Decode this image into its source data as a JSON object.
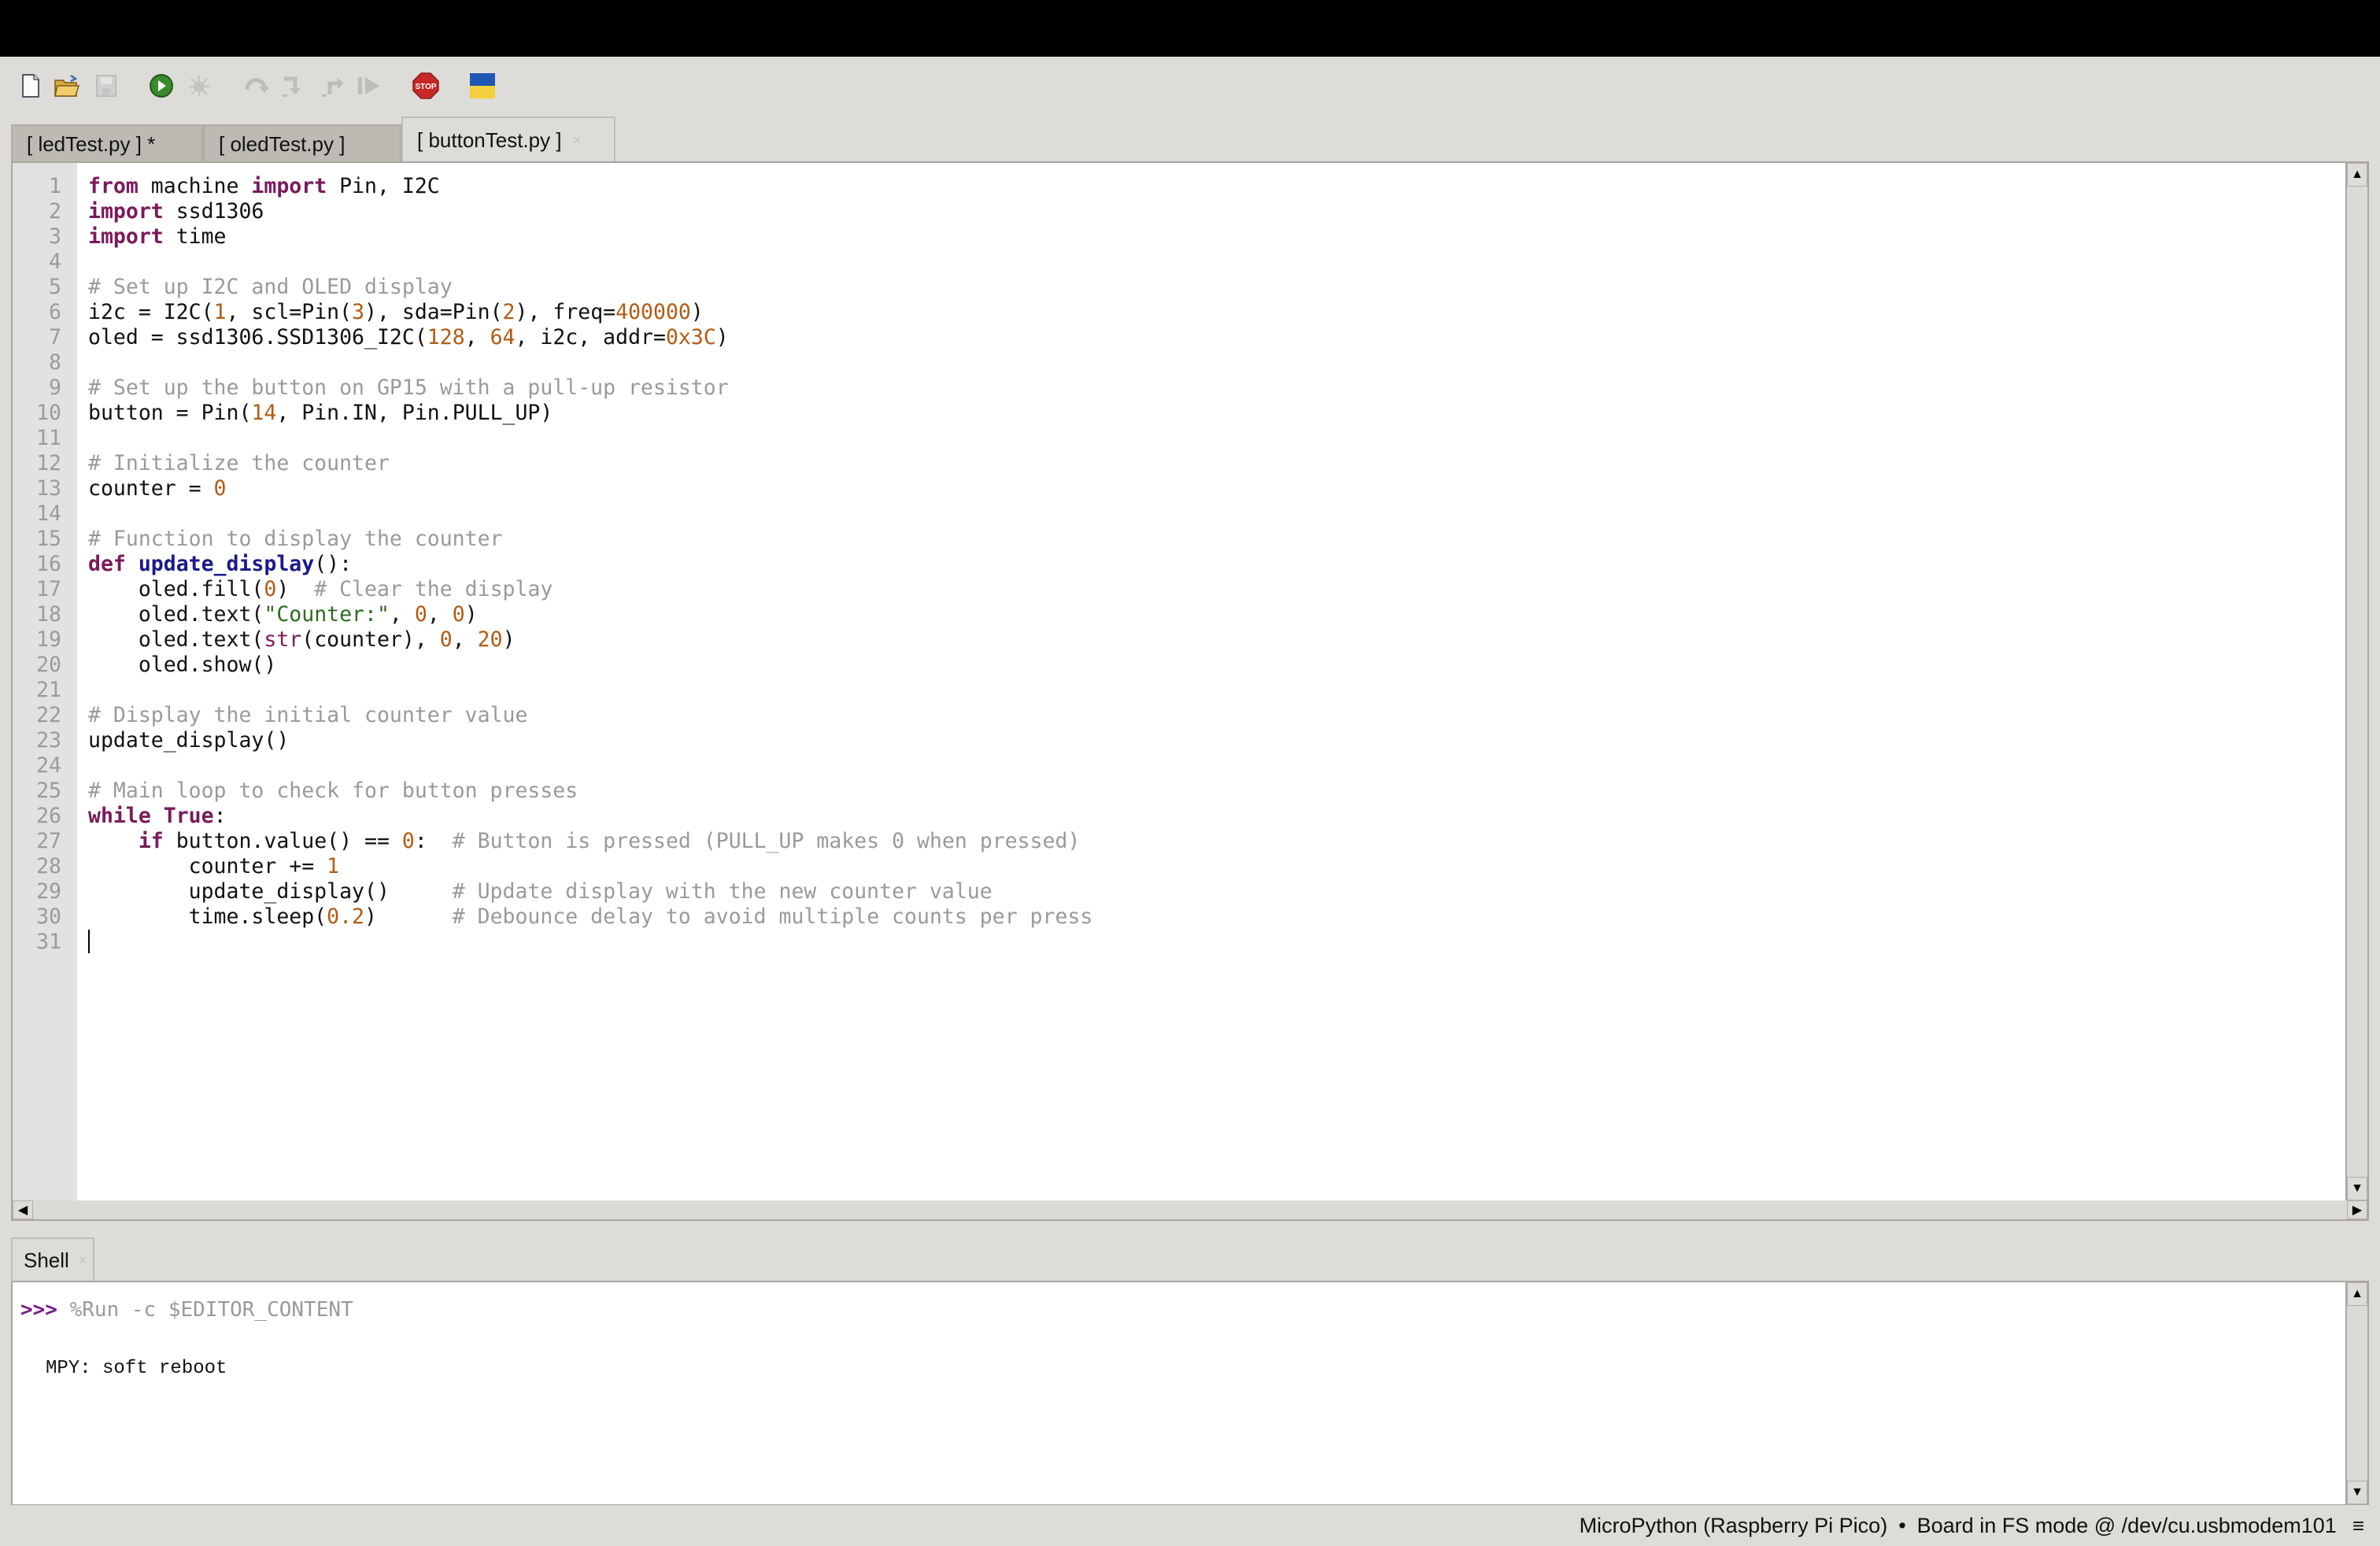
{
  "toolbar": {
    "buttons": [
      {
        "name": "new-file",
        "icon": "new-file-icon",
        "enabled": true
      },
      {
        "name": "open-file",
        "icon": "folder-open-icon",
        "enabled": true
      },
      {
        "name": "save-file",
        "icon": "save-icon",
        "enabled": false
      },
      {
        "name": "run",
        "icon": "play-icon",
        "enabled": true
      },
      {
        "name": "debug",
        "icon": "bug-icon",
        "enabled": false
      },
      {
        "name": "step-over",
        "icon": "step-over-icon",
        "enabled": false
      },
      {
        "name": "step-into",
        "icon": "step-into-icon",
        "enabled": false
      },
      {
        "name": "step-out",
        "icon": "step-out-icon",
        "enabled": false
      },
      {
        "name": "resume",
        "icon": "resume-icon",
        "enabled": false
      },
      {
        "name": "stop",
        "icon": "stop-icon",
        "label": "STOP",
        "enabled": true
      },
      {
        "name": "support-ukraine",
        "icon": "ukraine-flag-icon",
        "enabled": true
      }
    ],
    "colors": {
      "run": "#3a8a2e",
      "stop": "#c62828",
      "flag_blue": "#1f57b5",
      "flag_yellow": "#f2cf3c"
    }
  },
  "tabs": [
    {
      "label": "[ ledTest.py ] *",
      "active": false,
      "close": "×"
    },
    {
      "label": "[ oledTest.py ]",
      "active": false,
      "close": "×"
    },
    {
      "label": "[ buttonTest.py ]",
      "active": true,
      "close": "×"
    }
  ],
  "editor": {
    "lines": [
      [
        [
          "kw",
          "from"
        ],
        [
          "",
          "  machine "
        ],
        [
          "kw",
          "import"
        ],
        [
          "",
          " Pin, I2C"
        ]
      ],
      [
        [
          "kw",
          "import"
        ],
        [
          "",
          " ssd1306"
        ]
      ],
      [
        [
          "kw",
          "import"
        ],
        [
          "",
          " time"
        ]
      ],
      [],
      [
        [
          "cm",
          "# Set up I2C and OLED display"
        ]
      ],
      [
        [
          "",
          "i2c = I2C("
        ],
        [
          "num",
          "1"
        ],
        [
          "",
          ", scl=Pin("
        ],
        [
          "num",
          "3"
        ],
        [
          "",
          "), sda=Pin("
        ],
        [
          "num",
          "2"
        ],
        [
          "",
          "), freq="
        ],
        [
          "num",
          "400000"
        ],
        [
          "",
          ")"
        ]
      ],
      [
        [
          "",
          "oled = ssd1306.SSD1306_I2C("
        ],
        [
          "num",
          "128"
        ],
        [
          "",
          ", "
        ],
        [
          "num",
          "64"
        ],
        [
          "",
          ", i2c, addr="
        ],
        [
          "num",
          "0x3C"
        ],
        [
          "",
          ")"
        ]
      ],
      [],
      [
        [
          "cm",
          "# Set up the button on GP15 with a pull-up resistor"
        ]
      ],
      [
        [
          "",
          "button = Pin("
        ],
        [
          "num",
          "14"
        ],
        [
          "",
          ", Pin.IN, Pin.PULL_UP)"
        ]
      ],
      [],
      [
        [
          "cm",
          "# Initialize the counter"
        ]
      ],
      [
        [
          "",
          "counter = "
        ],
        [
          "num",
          "0"
        ]
      ],
      [],
      [
        [
          "cm",
          "# Function to display the counter"
        ]
      ],
      [
        [
          "kw",
          "def"
        ],
        [
          "",
          " "
        ],
        [
          "fn",
          "update_display"
        ],
        [
          "",
          "():"
        ]
      ],
      [
        [
          "",
          "    oled.fill("
        ],
        [
          "num",
          "0"
        ],
        [
          "",
          ")  "
        ],
        [
          "cm",
          "# Clear the display"
        ]
      ],
      [
        [
          "",
          "    oled.text("
        ],
        [
          "str",
          "\"Counter:\""
        ],
        [
          "",
          ", "
        ],
        [
          "num",
          "0"
        ],
        [
          "",
          ", "
        ],
        [
          "num",
          "0"
        ],
        [
          "",
          ")"
        ]
      ],
      [
        [
          "",
          "    oled.text("
        ],
        [
          "bi",
          "str"
        ],
        [
          "",
          "(counter), "
        ],
        [
          "num",
          "0"
        ],
        [
          "",
          ", "
        ],
        [
          "num",
          "20"
        ],
        [
          "",
          ")"
        ]
      ],
      [
        [
          "",
          "    oled.show()"
        ]
      ],
      [],
      [
        [
          "cm",
          "# Display the initial counter value"
        ]
      ],
      [
        [
          "",
          "update_display()"
        ]
      ],
      [],
      [
        [
          "cm",
          "# Main loop to check for button presses"
        ]
      ],
      [
        [
          "kw",
          "while"
        ],
        [
          "",
          " "
        ],
        [
          "kw",
          "True"
        ],
        [
          "",
          ":"
        ]
      ],
      [
        [
          "",
          "    "
        ],
        [
          "kw",
          "if"
        ],
        [
          "",
          " button.value() == "
        ],
        [
          "num",
          "0"
        ],
        [
          "",
          ":  "
        ],
        [
          "cm",
          "# Button is pressed (PULL_UP makes 0 when pressed)"
        ]
      ],
      [
        [
          "",
          "        counter += "
        ],
        [
          "num",
          "1"
        ]
      ],
      [
        [
          "",
          "        update_display()     "
        ],
        [
          "cm",
          "# Update display with the new counter value"
        ]
      ],
      [
        [
          "",
          "        time.sleep("
        ],
        [
          "num",
          "0.2"
        ],
        [
          "",
          ")      "
        ],
        [
          "cm",
          "# Debounce delay to avoid multiple counts per press"
        ]
      ],
      []
    ],
    "cursor_line": 31
  },
  "shell": {
    "tab_label": "Shell",
    "tab_close": "×",
    "prompt": ">>>",
    "command": "%Run -c $EDITOR_CONTENT",
    "output": "MPY: soft reboot"
  },
  "status": {
    "interpreter": "MicroPython (Raspberry Pi Pico)",
    "separator": "•",
    "board": "Board in FS mode @ /dev/cu.usbmodem101",
    "menu_icon": "≡"
  }
}
